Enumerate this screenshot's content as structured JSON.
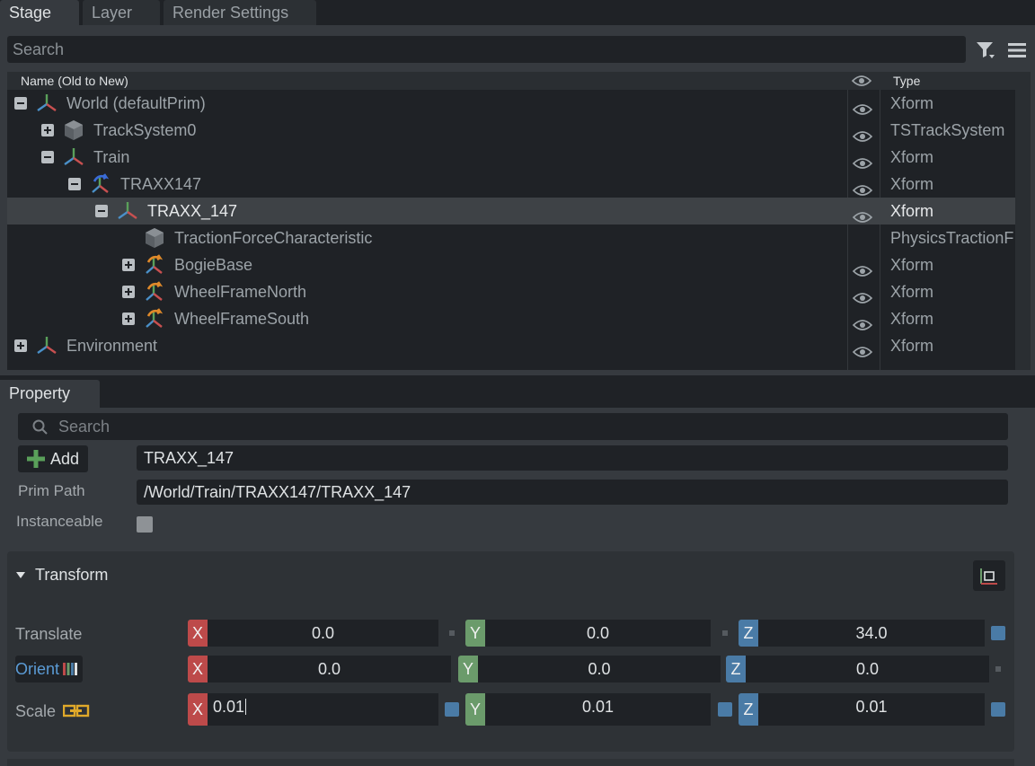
{
  "tabs": [
    "Stage",
    "Layer",
    "Render Settings"
  ],
  "stage": {
    "search_placeholder": "Search",
    "header": {
      "name": "Name (Old to New)",
      "type": "Type"
    },
    "rows": [
      {
        "label": "World (defaultPrim)",
        "type": "Xform",
        "expander": "minus",
        "icon": "xform",
        "eye": true,
        "depth": 0,
        "selected": false
      },
      {
        "label": "TrackSystem0",
        "type": "TSTrackSystem",
        "expander": "plus",
        "icon": "cube",
        "eye": true,
        "depth": 1,
        "selected": false
      },
      {
        "label": "Train",
        "type": "Xform",
        "expander": "minus",
        "icon": "xform",
        "eye": true,
        "depth": 1,
        "selected": false
      },
      {
        "label": "TRAXX147",
        "type": "Xform",
        "expander": "minus",
        "icon": "xform-ref-blue",
        "eye": true,
        "depth": 2,
        "selected": false
      },
      {
        "label": "TRAXX_147",
        "type": "Xform",
        "expander": "minus",
        "icon": "xform",
        "eye": true,
        "depth": 3,
        "selected": true
      },
      {
        "label": "TractionForceCharacteristic",
        "type": "PhysicsTractionF",
        "expander": "none",
        "icon": "cube",
        "eye": false,
        "depth": 4,
        "selected": false
      },
      {
        "label": "BogieBase",
        "type": "Xform",
        "expander": "plus",
        "icon": "xform-ref-orange",
        "eye": true,
        "depth": 4,
        "selected": false
      },
      {
        "label": "WheelFrameNorth",
        "type": "Xform",
        "expander": "plus",
        "icon": "xform-ref-orange",
        "eye": true,
        "depth": 4,
        "selected": false
      },
      {
        "label": "WheelFrameSouth",
        "type": "Xform",
        "expander": "plus",
        "icon": "xform-ref-orange",
        "eye": true,
        "depth": 4,
        "selected": false
      },
      {
        "label": "Environment",
        "type": "Xform",
        "expander": "plus",
        "icon": "xform",
        "eye": true,
        "depth": 0,
        "selected": false
      }
    ]
  },
  "property": {
    "tab": "Property",
    "search_placeholder": "Search",
    "add_label": "Add",
    "prim_name": "TRAXX_147",
    "prim_path_label": "Prim Path",
    "prim_path": "/World/Train/TRAXX147/TRAXX_147",
    "instanceable_label": "Instanceable",
    "transform": {
      "title": "Transform",
      "translate": {
        "label": "Translate",
        "x": "0.0",
        "y": "0.0",
        "z": "34.0"
      },
      "orient": {
        "label": "Orient",
        "x": "0.0",
        "y": "0.0",
        "z": "0.0"
      },
      "scale": {
        "label": "Scale",
        "x": "0.01",
        "y": "0.01",
        "z": "0.01"
      }
    }
  },
  "colors": {
    "axis_x": "#bd4a4a",
    "axis_y": "#6b9b6b",
    "axis_z": "#4a7ba6",
    "orient_label": "#5b9bd5",
    "scale_link": "#e0a92a"
  }
}
